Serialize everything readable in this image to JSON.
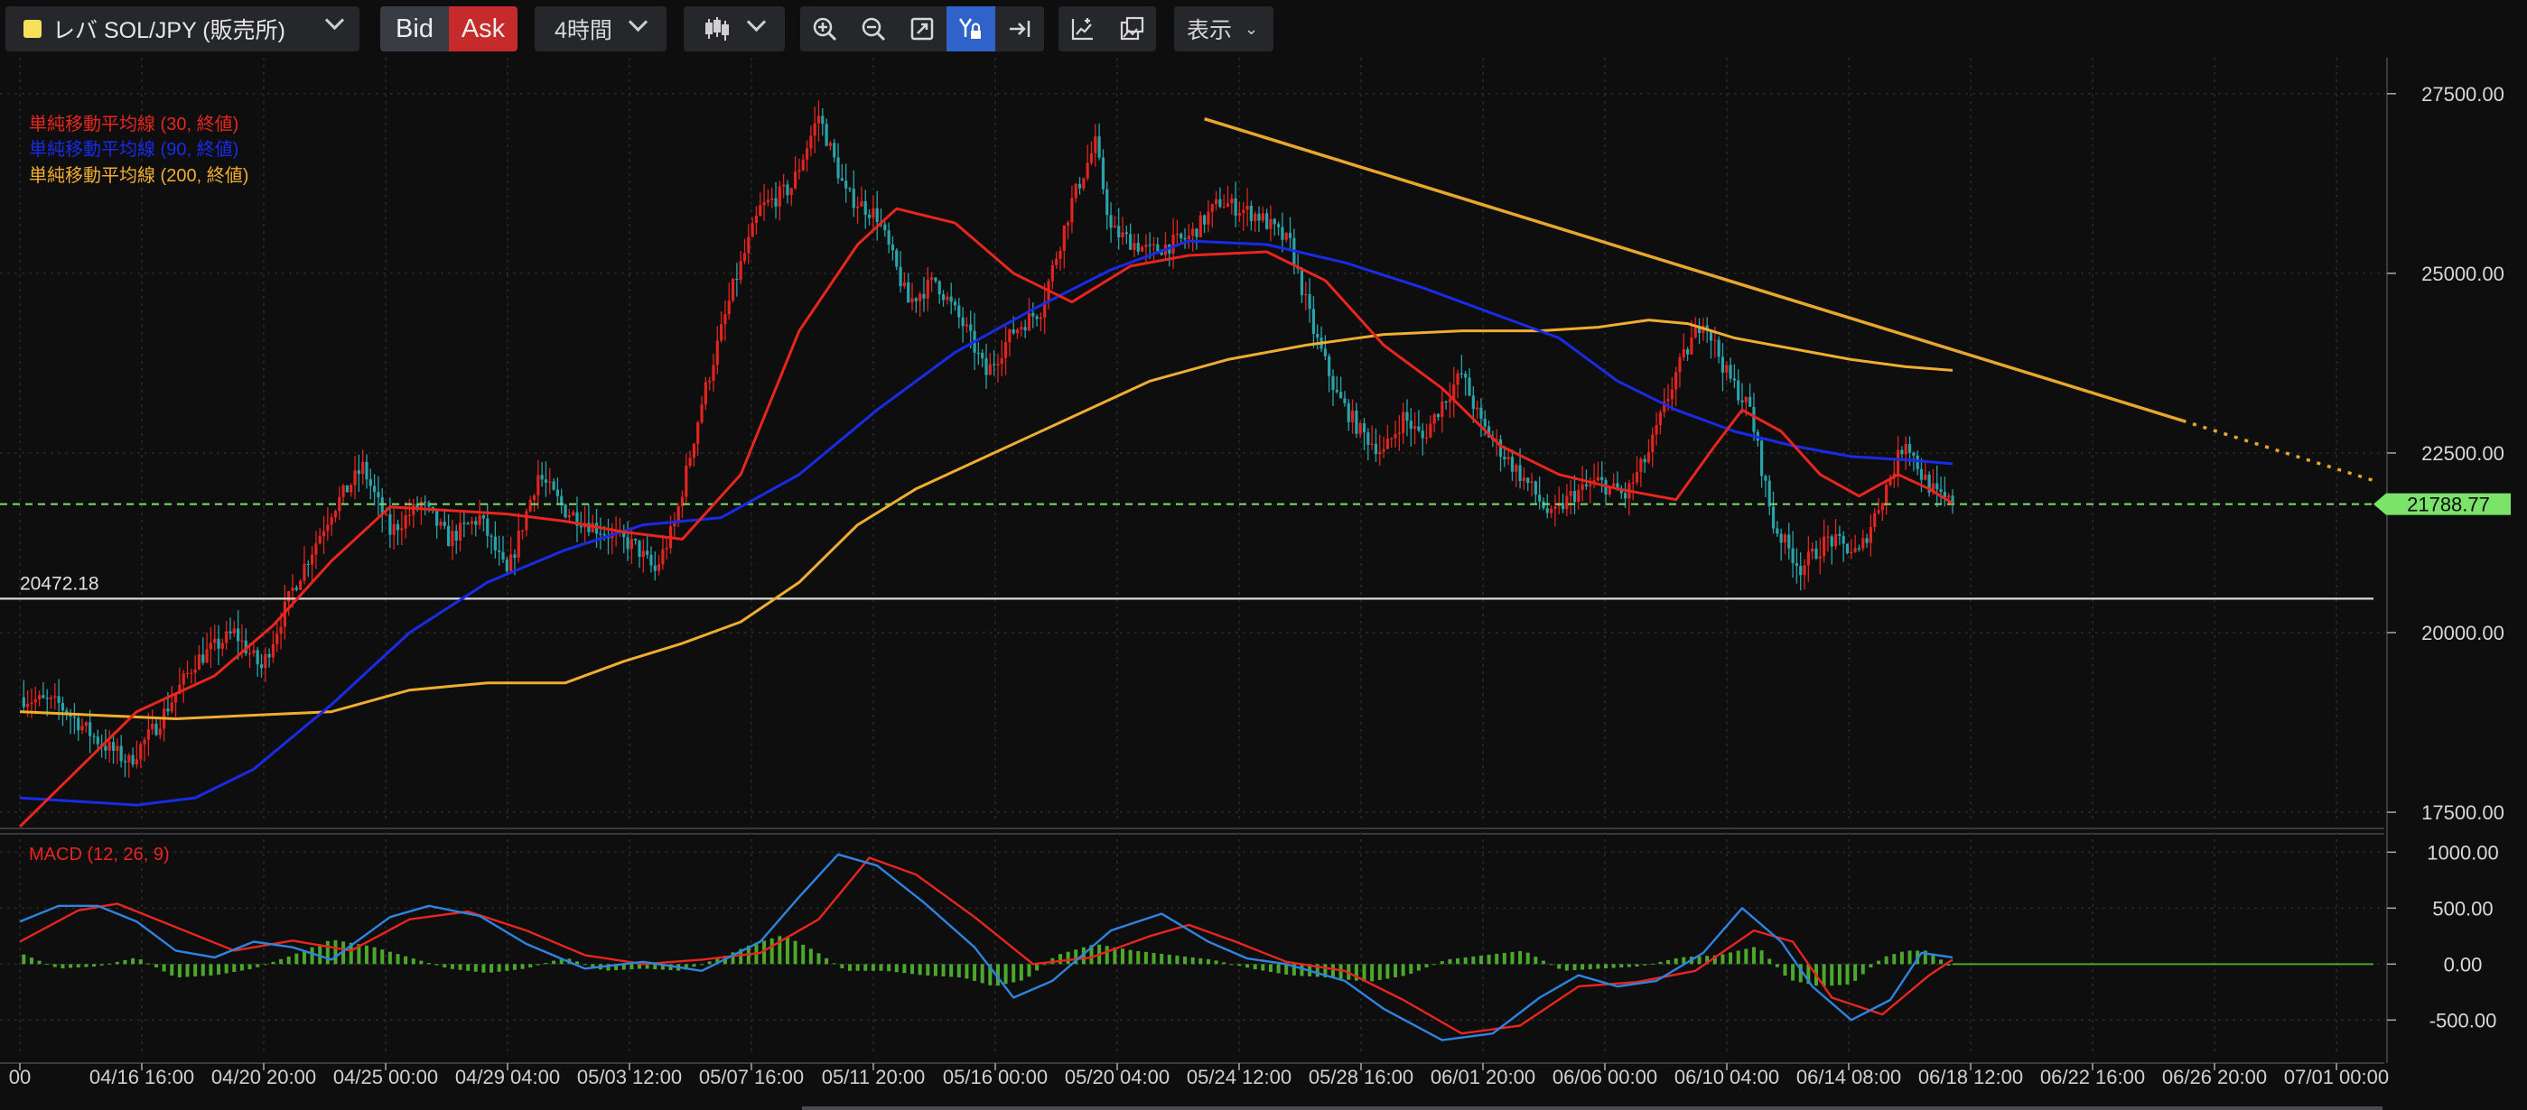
{
  "toolbar": {
    "symbol": "レバ SOL/JPY (販売所)",
    "bid_label": "Bid",
    "ask_label": "Ask",
    "timeframe": "4時間",
    "view_label": "表示",
    "icons": [
      "candlestick-icon",
      "zoom-in-icon",
      "zoom-out-icon",
      "fit-screen-icon",
      "y-axis-lock-icon",
      "scroll-to-latest-icon",
      "add-indicator-icon",
      "compare-icon"
    ]
  },
  "legend": {
    "sma30": "単純移動平均線 (30, 終値)",
    "sma90": "単純移動平均線 (90, 終値)",
    "sma200": "単純移動平均線 (200, 終値)",
    "macd": "MACD (12, 26, 9)"
  },
  "colors": {
    "background": "#0e0e0f",
    "up": "#e0241f",
    "down": "#2aa3a8",
    "sma30": "#e8261d",
    "sma90": "#1a2be6",
    "sma200": "#f0ad30",
    "trendline": "#e8a72c",
    "current_price": "#7be36a",
    "support": "#d8d8d8",
    "macd_line": "#2f84e0",
    "signal_line": "#e8261d",
    "histogram": "#4aa82a"
  },
  "chart_data": [
    {
      "type": "candlestick",
      "title": "",
      "y_ticks": [
        17500,
        20000,
        22500,
        25000,
        27500
      ],
      "y_tick_labels": [
        "17500.00",
        "20000.00",
        "22500.00",
        "25000.00",
        "27500.00"
      ],
      "ylim": [
        17350,
        28000
      ],
      "x_tick_labels": [
        "00",
        "04/16 16:00",
        "04/20 20:00",
        "04/25 00:00",
        "04/29 04:00",
        "05/03 12:00",
        "05/07 16:00",
        "05/11 20:00",
        "05/16 00:00",
        "05/20 04:00",
        "05/24 12:00",
        "05/28 16:00",
        "06/01 20:00",
        "06/06 00:00",
        "06/10 04:00",
        "06/14 08:00",
        "06/18 12:00",
        "06/22 16:00",
        "06/26 20:00",
        "07/01 00:00"
      ],
      "current_price": 21788.77,
      "current_price_label": "21788.77",
      "support_level": 20472.18,
      "support_label": "20472.18",
      "price_path": [
        [
          0,
          19100
        ],
        [
          10,
          19000
        ],
        [
          20,
          18500
        ],
        [
          28,
          18200
        ],
        [
          35,
          18700
        ],
        [
          45,
          19600
        ],
        [
          55,
          20000
        ],
        [
          62,
          19500
        ],
        [
          70,
          20600
        ],
        [
          80,
          21700
        ],
        [
          88,
          22300
        ],
        [
          95,
          21400
        ],
        [
          103,
          21800
        ],
        [
          110,
          21300
        ],
        [
          118,
          21600
        ],
        [
          125,
          20800
        ],
        [
          133,
          22200
        ],
        [
          140,
          21700
        ],
        [
          150,
          21400
        ],
        [
          158,
          21200
        ],
        [
          163,
          20850
        ],
        [
          168,
          21500
        ],
        [
          175,
          23200
        ],
        [
          183,
          24800
        ],
        [
          190,
          25900
        ],
        [
          198,
          26200
        ],
        [
          205,
          27200
        ],
        [
          212,
          26100
        ],
        [
          220,
          25800
        ],
        [
          228,
          24600
        ],
        [
          235,
          24900
        ],
        [
          243,
          24200
        ],
        [
          248,
          23600
        ],
        [
          255,
          24200
        ],
        [
          262,
          24500
        ],
        [
          270,
          26000
        ],
        [
          276,
          26800
        ],
        [
          280,
          25600
        ],
        [
          290,
          25300
        ],
        [
          300,
          25500
        ],
        [
          308,
          26000
        ],
        [
          318,
          25800
        ],
        [
          326,
          25400
        ],
        [
          332,
          24200
        ],
        [
          338,
          23300
        ],
        [
          344,
          22800
        ],
        [
          350,
          22500
        ],
        [
          355,
          23000
        ],
        [
          360,
          22700
        ],
        [
          365,
          23200
        ],
        [
          370,
          23600
        ],
        [
          375,
          22900
        ],
        [
          382,
          22400
        ],
        [
          388,
          22000
        ],
        [
          393,
          21600
        ],
        [
          398,
          21900
        ],
        [
          405,
          22100
        ],
        [
          412,
          21900
        ],
        [
          418,
          22500
        ],
        [
          425,
          23600
        ],
        [
          432,
          24400
        ],
        [
          438,
          23600
        ],
        [
          444,
          23100
        ],
        [
          450,
          21500
        ],
        [
          457,
          20900
        ],
        [
          464,
          21300
        ],
        [
          472,
          21100
        ],
        [
          478,
          21900
        ],
        [
          484,
          22700
        ],
        [
          488,
          22200
        ],
        [
          492,
          21900
        ],
        [
          496,
          21788.77
        ]
      ],
      "sma30": [
        [
          0,
          17300
        ],
        [
          15,
          18100
        ],
        [
          30,
          18900
        ],
        [
          50,
          19400
        ],
        [
          65,
          20100
        ],
        [
          80,
          21000
        ],
        [
          95,
          21750
        ],
        [
          110,
          21700
        ],
        [
          125,
          21650
        ],
        [
          140,
          21550
        ],
        [
          155,
          21400
        ],
        [
          170,
          21300
        ],
        [
          185,
          22200
        ],
        [
          200,
          24200
        ],
        [
          215,
          25400
        ],
        [
          225,
          25900
        ],
        [
          240,
          25700
        ],
        [
          255,
          25000
        ],
        [
          270,
          24600
        ],
        [
          285,
          25100
        ],
        [
          300,
          25250
        ],
        [
          320,
          25300
        ],
        [
          335,
          24900
        ],
        [
          350,
          24000
        ],
        [
          365,
          23400
        ],
        [
          380,
          22600
        ],
        [
          395,
          22200
        ],
        [
          410,
          22000
        ],
        [
          425,
          21850
        ],
        [
          435,
          22600
        ],
        [
          442,
          23100
        ],
        [
          452,
          22800
        ],
        [
          462,
          22200
        ],
        [
          472,
          21900
        ],
        [
          482,
          22200
        ],
        [
          490,
          22000
        ],
        [
          496,
          21800
        ]
      ],
      "sma90": [
        [
          0,
          17700
        ],
        [
          30,
          17600
        ],
        [
          45,
          17700
        ],
        [
          60,
          18100
        ],
        [
          80,
          19000
        ],
        [
          100,
          20000
        ],
        [
          120,
          20700
        ],
        [
          140,
          21150
        ],
        [
          160,
          21500
        ],
        [
          180,
          21600
        ],
        [
          200,
          22200
        ],
        [
          220,
          23100
        ],
        [
          240,
          23900
        ],
        [
          260,
          24500
        ],
        [
          280,
          25050
        ],
        [
          300,
          25450
        ],
        [
          320,
          25400
        ],
        [
          340,
          25150
        ],
        [
          360,
          24800
        ],
        [
          380,
          24400
        ],
        [
          395,
          24100
        ],
        [
          410,
          23500
        ],
        [
          425,
          23100
        ],
        [
          440,
          22800
        ],
        [
          455,
          22600
        ],
        [
          470,
          22450
        ],
        [
          485,
          22400
        ],
        [
          496,
          22350
        ]
      ],
      "sma200": [
        [
          0,
          18900
        ],
        [
          40,
          18800
        ],
        [
          80,
          18900
        ],
        [
          100,
          19200
        ],
        [
          120,
          19300
        ],
        [
          140,
          19300
        ],
        [
          155,
          19600
        ],
        [
          170,
          19850
        ],
        [
          185,
          20150
        ],
        [
          200,
          20700
        ],
        [
          215,
          21500
        ],
        [
          230,
          22000
        ],
        [
          250,
          22500
        ],
        [
          270,
          23000
        ],
        [
          290,
          23500
        ],
        [
          310,
          23800
        ],
        [
          330,
          24000
        ],
        [
          350,
          24150
        ],
        [
          370,
          24200
        ],
        [
          390,
          24200
        ],
        [
          405,
          24250
        ],
        [
          418,
          24350
        ],
        [
          428,
          24300
        ],
        [
          440,
          24100
        ],
        [
          455,
          23950
        ],
        [
          470,
          23800
        ],
        [
          484,
          23700
        ],
        [
          496,
          23650
        ]
      ],
      "trendline": {
        "start": [
          304,
          27150
        ],
        "end": [
          555,
          22950
        ],
        "dotted_end": [
          605,
          22100
        ]
      },
      "macd": {
        "y_ticks": [
          -500,
          0,
          500,
          1000
        ],
        "y_tick_labels": [
          "-500.00",
          "0.00",
          "500.00",
          "1000.00"
        ],
        "ylim": [
          -820,
          1180
        ],
        "macd_line": [
          [
            0,
            380
          ],
          [
            10,
            520
          ],
          [
            20,
            520
          ],
          [
            30,
            380
          ],
          [
            40,
            120
          ],
          [
            50,
            60
          ],
          [
            60,
            200
          ],
          [
            70,
            150
          ],
          [
            80,
            40
          ],
          [
            95,
            420
          ],
          [
            105,
            520
          ],
          [
            118,
            430
          ],
          [
            130,
            180
          ],
          [
            145,
            -40
          ],
          [
            160,
            20
          ],
          [
            175,
            -60
          ],
          [
            190,
            200
          ],
          [
            200,
            600
          ],
          [
            210,
            980
          ],
          [
            220,
            880
          ],
          [
            232,
            550
          ],
          [
            245,
            150
          ],
          [
            255,
            -300
          ],
          [
            265,
            -150
          ],
          [
            280,
            300
          ],
          [
            293,
            450
          ],
          [
            305,
            200
          ],
          [
            315,
            50
          ],
          [
            325,
            0
          ],
          [
            340,
            -150
          ],
          [
            350,
            -400
          ],
          [
            365,
            -680
          ],
          [
            378,
            -620
          ],
          [
            390,
            -300
          ],
          [
            400,
            -100
          ],
          [
            410,
            -200
          ],
          [
            420,
            -150
          ],
          [
            432,
            100
          ],
          [
            442,
            500
          ],
          [
            452,
            200
          ],
          [
            460,
            -200
          ],
          [
            470,
            -500
          ],
          [
            480,
            -320
          ],
          [
            488,
            100
          ],
          [
            496,
            60
          ]
        ],
        "signal_line": [
          [
            0,
            200
          ],
          [
            15,
            480
          ],
          [
            25,
            540
          ],
          [
            40,
            330
          ],
          [
            55,
            120
          ],
          [
            70,
            210
          ],
          [
            85,
            120
          ],
          [
            100,
            400
          ],
          [
            115,
            470
          ],
          [
            130,
            300
          ],
          [
            145,
            80
          ],
          [
            160,
            0
          ],
          [
            175,
            40
          ],
          [
            190,
            100
          ],
          [
            205,
            400
          ],
          [
            218,
            950
          ],
          [
            230,
            800
          ],
          [
            245,
            420
          ],
          [
            260,
            0
          ],
          [
            275,
            60
          ],
          [
            290,
            250
          ],
          [
            300,
            350
          ],
          [
            312,
            200
          ],
          [
            325,
            20
          ],
          [
            340,
            -60
          ],
          [
            355,
            -320
          ],
          [
            370,
            -620
          ],
          [
            385,
            -550
          ],
          [
            400,
            -200
          ],
          [
            415,
            -160
          ],
          [
            430,
            -60
          ],
          [
            445,
            300
          ],
          [
            455,
            200
          ],
          [
            465,
            -300
          ],
          [
            478,
            -450
          ],
          [
            490,
            -100
          ],
          [
            496,
            40
          ]
        ],
        "histogram": [
          [
            0,
            100
          ],
          [
            10,
            -40
          ],
          [
            20,
            -20
          ],
          [
            30,
            60
          ],
          [
            40,
            -120
          ],
          [
            50,
            -100
          ],
          [
            60,
            -40
          ],
          [
            70,
            80
          ],
          [
            80,
            220
          ],
          [
            90,
            160
          ],
          [
            100,
            60
          ],
          [
            110,
            -40
          ],
          [
            120,
            -80
          ],
          [
            130,
            -40
          ],
          [
            140,
            60
          ],
          [
            150,
            -60
          ],
          [
            160,
            -40
          ],
          [
            170,
            -60
          ],
          [
            180,
            60
          ],
          [
            188,
            180
          ],
          [
            196,
            260
          ],
          [
            204,
            120
          ],
          [
            212,
            -60
          ],
          [
            222,
            -60
          ],
          [
            232,
            -100
          ],
          [
            242,
            -120
          ],
          [
            250,
            -200
          ],
          [
            258,
            -140
          ],
          [
            266,
            80
          ],
          [
            276,
            180
          ],
          [
            286,
            120
          ],
          [
            296,
            80
          ],
          [
            306,
            40
          ],
          [
            316,
            -40
          ],
          [
            326,
            -100
          ],
          [
            336,
            -120
          ],
          [
            346,
            -160
          ],
          [
            356,
            -100
          ],
          [
            366,
            40
          ],
          [
            376,
            80
          ],
          [
            386,
            120
          ],
          [
            396,
            -60
          ],
          [
            406,
            -40
          ],
          [
            416,
            -20
          ],
          [
            426,
            60
          ],
          [
            436,
            80
          ],
          [
            446,
            160
          ],
          [
            454,
            -140
          ],
          [
            462,
            -200
          ],
          [
            470,
            -180
          ],
          [
            478,
            60
          ],
          [
            484,
            120
          ],
          [
            490,
            120
          ],
          [
            496,
            -40
          ]
        ]
      }
    }
  ]
}
